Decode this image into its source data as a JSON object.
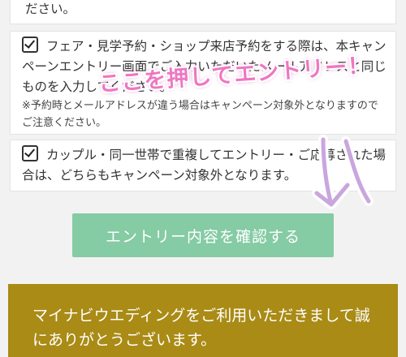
{
  "items": {
    "partial_line": "ださい。",
    "consent_fair": "フェア・見学予約・ショップ来店予約をする際は、本キャンペーンエントリー画面でご入力いただいたメールアドレスと同じものを入力してください。",
    "consent_fair_note": "※予約時とメールアドレスが違う場合はキャンペーン対象外となりますのでご注意ください。",
    "consent_couple": "カップル・同一世帯で重複してエントリー・ご応募された場合は、どちらもキャンペーン対象外となります。"
  },
  "button": {
    "confirm_label": "エントリー内容を確認する"
  },
  "banner": {
    "text": "マイナビウエディングをご利用いただきまして誠にありがとうございます。"
  },
  "annotation": {
    "text": "ここを押してエントリー！",
    "color": "#ee77c2"
  },
  "colors": {
    "button_bg": "#85cba4",
    "banner_bg": "#a98b16"
  }
}
